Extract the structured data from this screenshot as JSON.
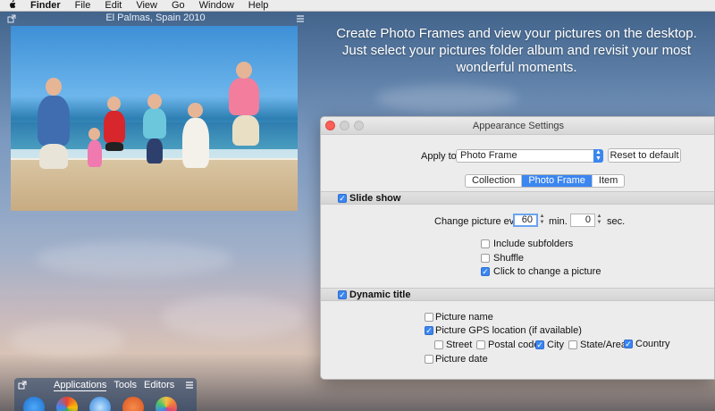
{
  "menubar": {
    "apple_icon": "apple-icon",
    "items": [
      "Finder",
      "File",
      "Edit",
      "View",
      "Go",
      "Window",
      "Help"
    ]
  },
  "photo_frame": {
    "caption": "El Palmas, Spain 2010"
  },
  "promo": {
    "line1": "Create Photo Frames and view your pictures on the desktop.",
    "line2": "Just select your pictures folder album and revisit your most",
    "line3": "wonderful moments."
  },
  "window": {
    "title": "Appearance Settings",
    "apply_to_label": "Apply to:",
    "apply_to_value": "Photo Frame",
    "reset_button": "Reset to default",
    "tabs": [
      {
        "label": "Collection",
        "selected": false
      },
      {
        "label": "Photo Frame",
        "selected": true
      },
      {
        "label": "Item",
        "selected": false
      }
    ],
    "slideshow": {
      "header": "Slide show",
      "checked": true,
      "change_label": "Change picture every:",
      "minutes": "60",
      "min_label": "min.",
      "seconds": "0",
      "sec_label": "sec.",
      "options": [
        {
          "label": "Include subfolders",
          "checked": false
        },
        {
          "label": "Shuffle",
          "checked": false
        },
        {
          "label": "Click to change a picture",
          "checked": true
        }
      ]
    },
    "dynamic_title": {
      "header": "Dynamic title",
      "checked": true,
      "picture_name": {
        "label": "Picture name",
        "checked": false
      },
      "gps": {
        "label": "Picture GPS location (if available)",
        "checked": true
      },
      "gps_fields": [
        {
          "label": "Street",
          "checked": false
        },
        {
          "label": "Postal code",
          "checked": false
        },
        {
          "label": "City",
          "checked": true
        },
        {
          "label": "State/Area",
          "checked": false
        },
        {
          "label": "Country",
          "checked": true
        }
      ],
      "picture_date": {
        "label": "Picture date",
        "checked": false
      }
    }
  },
  "dock": {
    "tabs": [
      "Applications",
      "Tools",
      "Editors"
    ],
    "active_tab": "Applications"
  },
  "colors": {
    "accent": "#3b86f0",
    "close": "#fc5f57"
  }
}
